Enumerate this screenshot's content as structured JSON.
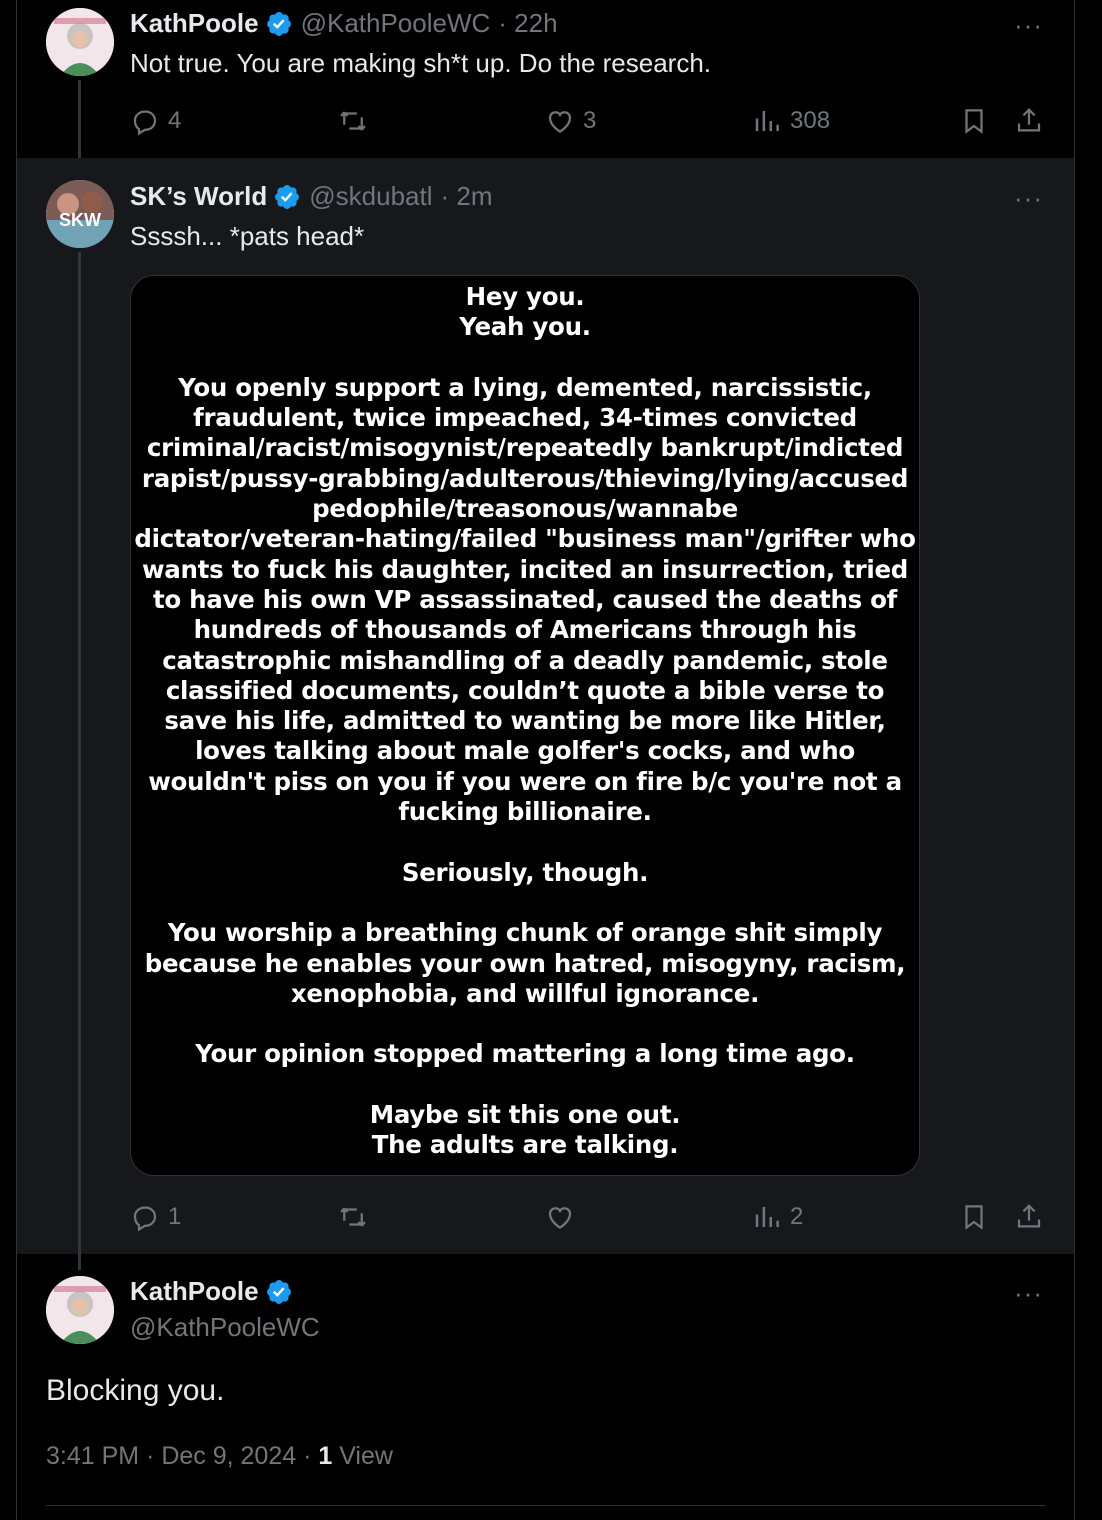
{
  "tweets": [
    {
      "name": "KathPoole",
      "handle": "@KathPooleWC",
      "time": "· 22h",
      "text": "Not true. You are making sh*t up. Do the research.",
      "replies": "4",
      "reposts": "",
      "likes": "3",
      "views": "308"
    },
    {
      "name": "SK’s World",
      "handle": "@skdubatl",
      "time": "· 2m",
      "text": "Ssssh... *pats head*",
      "image_text": "Hey you.\nYeah you.\n\nYou openly support a lying, demented, narcissistic,\nfraudulent, twice impeached, 34-times convicted\ncriminal/racist/misogynist/repeatedly bankrupt/indicted\nrapist/pussy-grabbing/adulterous/thieving/lying/accused\npedophile/treasonous/wannabe\ndictator/veteran-hating/failed \"business man\"/grifter who\nwants to fuck his daughter, incited an insurrection, tried\nto have his own VP assassinated, caused the deaths of\nhundreds of thousands of Americans through his\ncatastrophic mishandling of a deadly pandemic, stole\nclassified documents, couldn’t quote a bible verse to\nsave his life, admitted to wanting be more like Hitler,\nloves talking about male golfer's cocks, and who\nwouldn't piss on you if you were on fire b/c you're not a\nfucking billionaire.\n\nSeriously, though.\n\nYou worship a breathing chunk of orange shit simply\nbecause he enables your own hatred, misogyny, racism,\nxenophobia, and willful ignorance.\n\nYour opinion stopped mattering a long time ago.\n\nMaybe sit this one out.\nThe adults are talking.",
      "replies": "1",
      "reposts": "",
      "likes": "",
      "views": "2"
    }
  ],
  "main_tweet": {
    "name": "KathPoole",
    "handle": "@KathPooleWC",
    "text": "Blocking you.",
    "time": "3:41 PM · Dec 9, 2024 · ",
    "view_count": "1",
    "view_label": " View"
  },
  "more_label": "···",
  "avatar_texts": {
    "sk": "SKW"
  },
  "colors": {
    "background": "#000000",
    "secondary_bg": "#16181c",
    "verified": "#1d9bf0",
    "muted": "#71767b",
    "text": "#e7e9ea"
  }
}
